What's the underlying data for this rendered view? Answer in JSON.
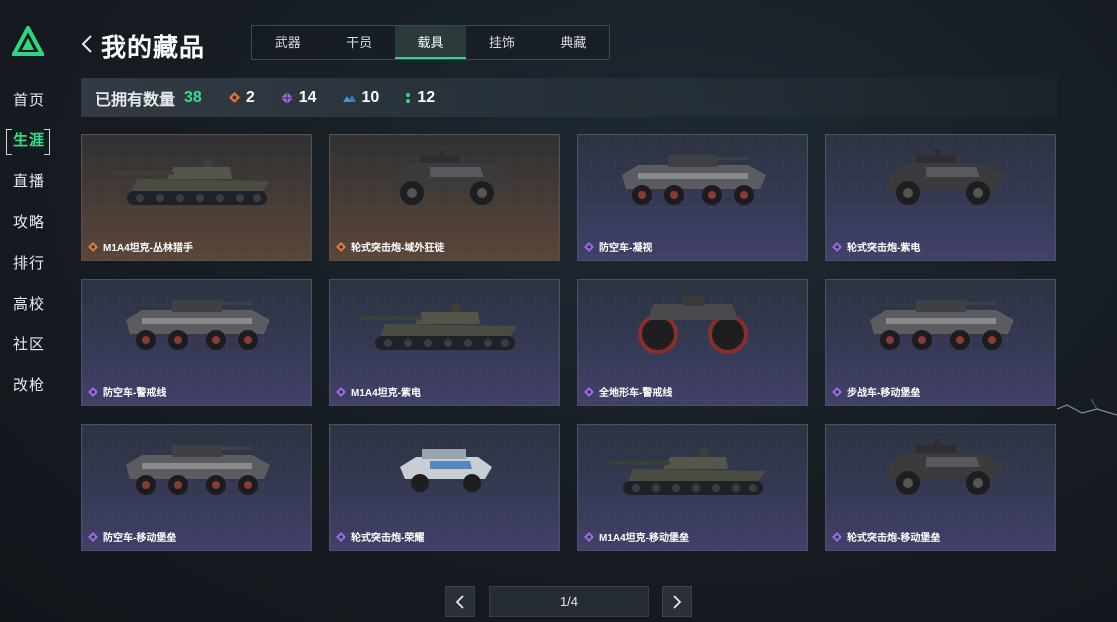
{
  "sidebar": {
    "items": [
      {
        "label": "首页",
        "active": false
      },
      {
        "label": "生涯",
        "active": true
      },
      {
        "label": "直播",
        "active": false
      },
      {
        "label": "攻略",
        "active": false
      },
      {
        "label": "排行",
        "active": false
      },
      {
        "label": "高校",
        "active": false
      },
      {
        "label": "社区",
        "active": false
      },
      {
        "label": "改枪",
        "active": false
      }
    ]
  },
  "header": {
    "title": "我的藏品"
  },
  "tabs": [
    {
      "label": "武器",
      "active": false
    },
    {
      "label": "干员",
      "active": false
    },
    {
      "label": "载具",
      "active": true
    },
    {
      "label": "挂饰",
      "active": false
    },
    {
      "label": "典藏",
      "active": false
    }
  ],
  "stats": {
    "label": "已拥有数量",
    "total": "38",
    "counts": [
      {
        "icon": "orange-diamond-icon",
        "value": "2",
        "color": "#e2773a"
      },
      {
        "icon": "purple-diamond-icon",
        "value": "14",
        "color": "#9a6ae0"
      },
      {
        "icon": "blue-chevron-icon",
        "value": "10",
        "color": "#4a8fe0"
      },
      {
        "icon": "green-dots-icon",
        "value": "12",
        "color": "#33d47f"
      }
    ]
  },
  "items": [
    {
      "name": "M1A4坦克-丛林猎手",
      "rarity": "gold",
      "vehicle": "tank"
    },
    {
      "name": "轮式突击炮-域外狂徒",
      "rarity": "gold",
      "vehicle": "buggy"
    },
    {
      "name": "防空车-凝视",
      "rarity": "purple",
      "vehicle": "apc"
    },
    {
      "name": "轮式突击炮-紫电",
      "rarity": "purple",
      "vehicle": "buggy"
    },
    {
      "name": "防空车-警戒线",
      "rarity": "purple",
      "vehicle": "apc"
    },
    {
      "name": "M1A4坦克-紫电",
      "rarity": "purple",
      "vehicle": "tank"
    },
    {
      "name": "全地形车-警戒线",
      "rarity": "purple",
      "vehicle": "atv"
    },
    {
      "name": "步战车-移动堡垒",
      "rarity": "purple",
      "vehicle": "apc"
    },
    {
      "name": "防空车-移动堡垒",
      "rarity": "purple",
      "vehicle": "apc"
    },
    {
      "name": "轮式突击炮-荣耀",
      "rarity": "purple",
      "vehicle": "jeep"
    },
    {
      "name": "M1A4坦克-移动堡垒",
      "rarity": "purple",
      "vehicle": "tank"
    },
    {
      "name": "轮式突击炮-移动堡垒",
      "rarity": "purple",
      "vehicle": "buggy"
    }
  ],
  "pager": {
    "text": "1/4"
  },
  "colors": {
    "accent": "#33e08a",
    "gold_rarity": "#e2773a",
    "purple_rarity": "#9a6ae0"
  }
}
